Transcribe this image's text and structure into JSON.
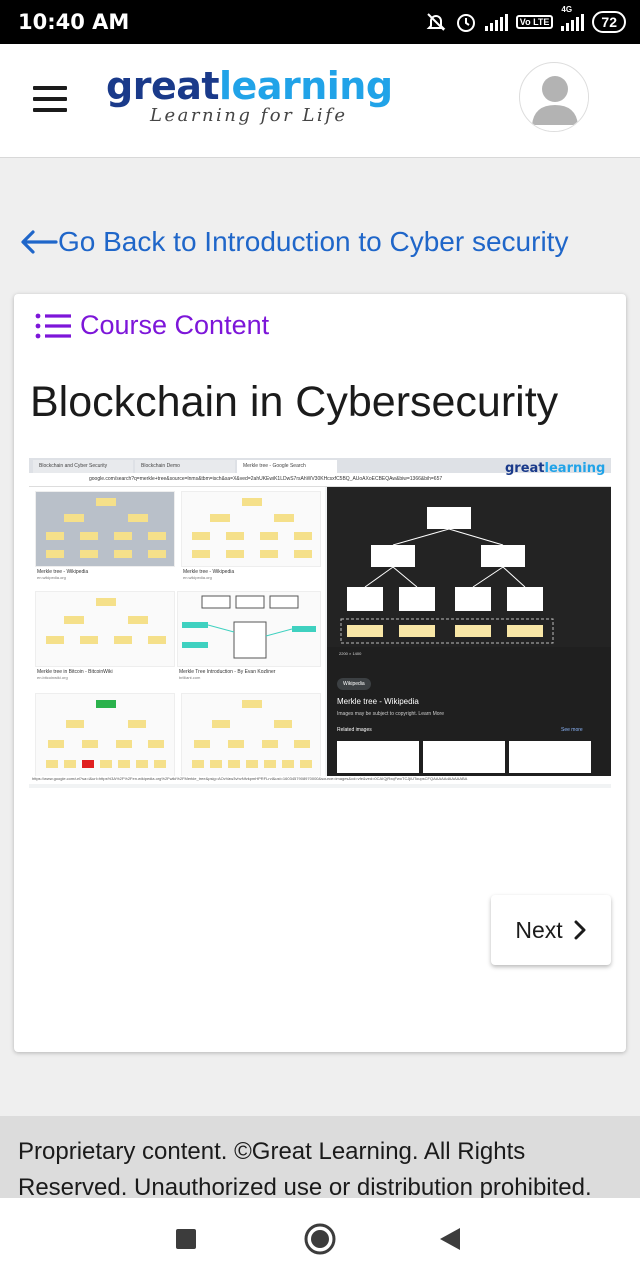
{
  "status_bar": {
    "time": "10:40 AM",
    "icons": [
      "mute-icon",
      "alarm-icon",
      "signal-icon",
      "volte-icon",
      "4g-signal-icon",
      "battery-icon"
    ],
    "volte": "Vo LTE",
    "network": "4G",
    "battery": "72"
  },
  "header": {
    "logo": {
      "brand_part1": "great",
      "brand_part2": "learning",
      "tagline": "Learning for Life"
    },
    "menu_icon": "hamburger-menu-icon",
    "avatar_icon": "user-avatar-icon"
  },
  "back_link": {
    "label": "Go Back to Introduction to Cyber security"
  },
  "course_content": {
    "label": "Course Content"
  },
  "lesson": {
    "title": "Blockchain in Cybersecurity",
    "screenshot": {
      "tabs": [
        "Blockchain and Cyber Security",
        "Blockchain Demo",
        "Merkle tree - Google Search"
      ],
      "url": "google.com/search?q=merkle+tree&source=lnms&tbm=isch&sa=X&ved=2ahUKEwiK1LDwS7rsAhWV30KHcsxfC5BQ_AUoAXoECBEQAw&biw=1366&bih=657",
      "logo": {
        "part1": "great",
        "part2": "learning"
      },
      "thumbnails": [
        {
          "title": "Merkle tree - Wikipedia",
          "source": "en.wikipedia.org"
        },
        {
          "title": "Merkle tree - Wikipedia",
          "source": "en.wikipedia.org"
        },
        {
          "title": "Merkle tree in Bitcoin - BitcoinWiki",
          "source": "en.bitcoinwiki.org"
        },
        {
          "title": "Merkle Tree Introduction - By Evan Kozliner",
          "source": "brilliant.com"
        }
      ],
      "preview": {
        "size": "2200 × 1400",
        "source_chip": "Wikipedia",
        "title": "Merkle tree - Wikipedia",
        "note": "Images may be subject to copyright. Learn More",
        "related": "Related images",
        "see_more": "See more"
      },
      "status_url": "https://www.google.com/url?sa=i&url=https%3A%2F%2Fen.wikipedia.org%2Fwiki%2FMerkle_tree&psig=AOvVaw3vhvNfvkpmHPRFLrvl&ust=1603457908970000&source=images&cd=vfe&ved=0CAIQjRxqFwoTCJjiUToupsCFQAAAAAdAAAAABA"
    }
  },
  "next_button": {
    "label": "Next"
  },
  "footer": {
    "text": "Proprietary content. ©Great Learning. All Rights Reserved. Unauthorized use or distribution prohibited."
  },
  "nav_bar": {
    "icons": [
      "recents-square-icon",
      "home-circle-icon",
      "back-triangle-icon"
    ]
  },
  "colors": {
    "link_blue": "#1f66c9",
    "course_purple": "#7d16d9",
    "logo_dark_blue": "#1a3a8a",
    "logo_light_blue": "#21a3e8"
  }
}
